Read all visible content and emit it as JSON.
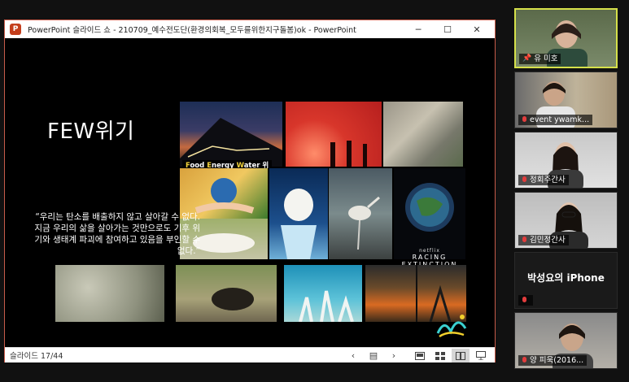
{
  "window": {
    "title": "PowerPoint 슬라이드 쇼  -  210709_예수전도단(환경의회복_모두를위한지구돌봄)ok  -  PowerPoint",
    "minimize": "─",
    "maximize": "☐",
    "close": "✕"
  },
  "slide": {
    "title": "FEW위기",
    "caption": {
      "f": "F",
      "ood": "ood ",
      "e": "E",
      "nergy": "nergy ",
      "w": "W",
      "ater": "ater 위기"
    },
    "quote": "“우리는 탄소를 배출하지 않고 살아갈 수 없다. 지금 우리의 삶을 살아가는 것만으로도 기후 위기와 생태계 파괴에 참여하고 있음을 부인할 수 없다.”",
    "poster_brand": "netflix",
    "poster_title": "RACING EXTINCTION"
  },
  "statusbar": {
    "slide_counter": "슬라이드 17/44",
    "prev_icon": "‹",
    "notes_icon": "▤",
    "next_icon": "›"
  },
  "participants": [
    {
      "name": "유 미호",
      "active": true,
      "muted": false
    },
    {
      "name": "event ywamk...",
      "muted": true
    },
    {
      "name": "정회주간사",
      "muted": true
    },
    {
      "name": "김민정간사",
      "muted": true
    },
    {
      "name": "",
      "device_label": "박성요의 iPhone",
      "muted": true
    },
    {
      "name": "양 피욱(2016...",
      "muted": true
    }
  ],
  "colors": {
    "accent_border": "#d5e04a",
    "ppt_red": "#c43e1c",
    "caption_yellow": "#f3d33a"
  }
}
